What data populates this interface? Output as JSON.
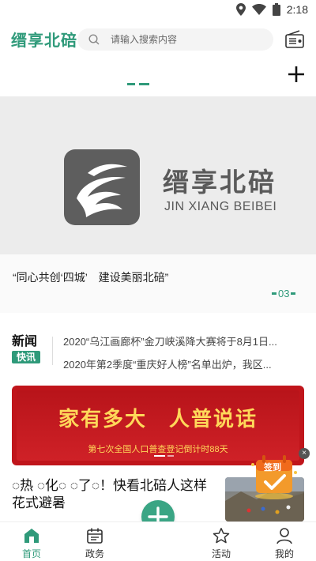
{
  "status_bar": {
    "time": "2:18",
    "icons": [
      "location-icon",
      "wifi-icon",
      "battery-icon"
    ]
  },
  "header": {
    "logo_text": "缙享北碚",
    "search": {
      "placeholder": "请输入搜索内容",
      "value": ""
    },
    "radio_icon": "radio-icon"
  },
  "tabs": {
    "add_icon": "plus-icon"
  },
  "banner": {
    "brand_cn": "缙享北碚",
    "brand_en": "JIN XIANG BEIBEI",
    "caption": "“同心共创‘四城’　建设美丽北碚”",
    "page_number": "03"
  },
  "news": {
    "label_top": "新闻",
    "label_badge": "快讯",
    "items": [
      "2020“乌江画廊杯”金刀峡溪降大赛将于8月1日...",
      "2020年第2季度“重庆好人榜”名单出炉，我区..."
    ]
  },
  "promo": {
    "headline": "家有多大　人普说话",
    "subline": "第七次全国人口普查登记倒计时88天"
  },
  "article": {
    "title": "◌热 ◌化◌ ◌了◌！快看北碚人这样花式避暑"
  },
  "signin": {
    "label": "签到",
    "close": "×"
  },
  "bottom_nav": {
    "items": [
      {
        "label": "首页",
        "icon": "home-icon",
        "active": true
      },
      {
        "label": "政务",
        "icon": "calendar-icon",
        "active": false
      },
      {
        "label": "活动",
        "icon": "star-icon",
        "active": false
      },
      {
        "label": "我的",
        "icon": "user-icon",
        "active": false
      }
    ],
    "fab_icon": "plus-icon"
  },
  "colors": {
    "accent": "#2f9a7a",
    "promo_red": "#c0151b",
    "promo_gold": "#ffd85a"
  }
}
